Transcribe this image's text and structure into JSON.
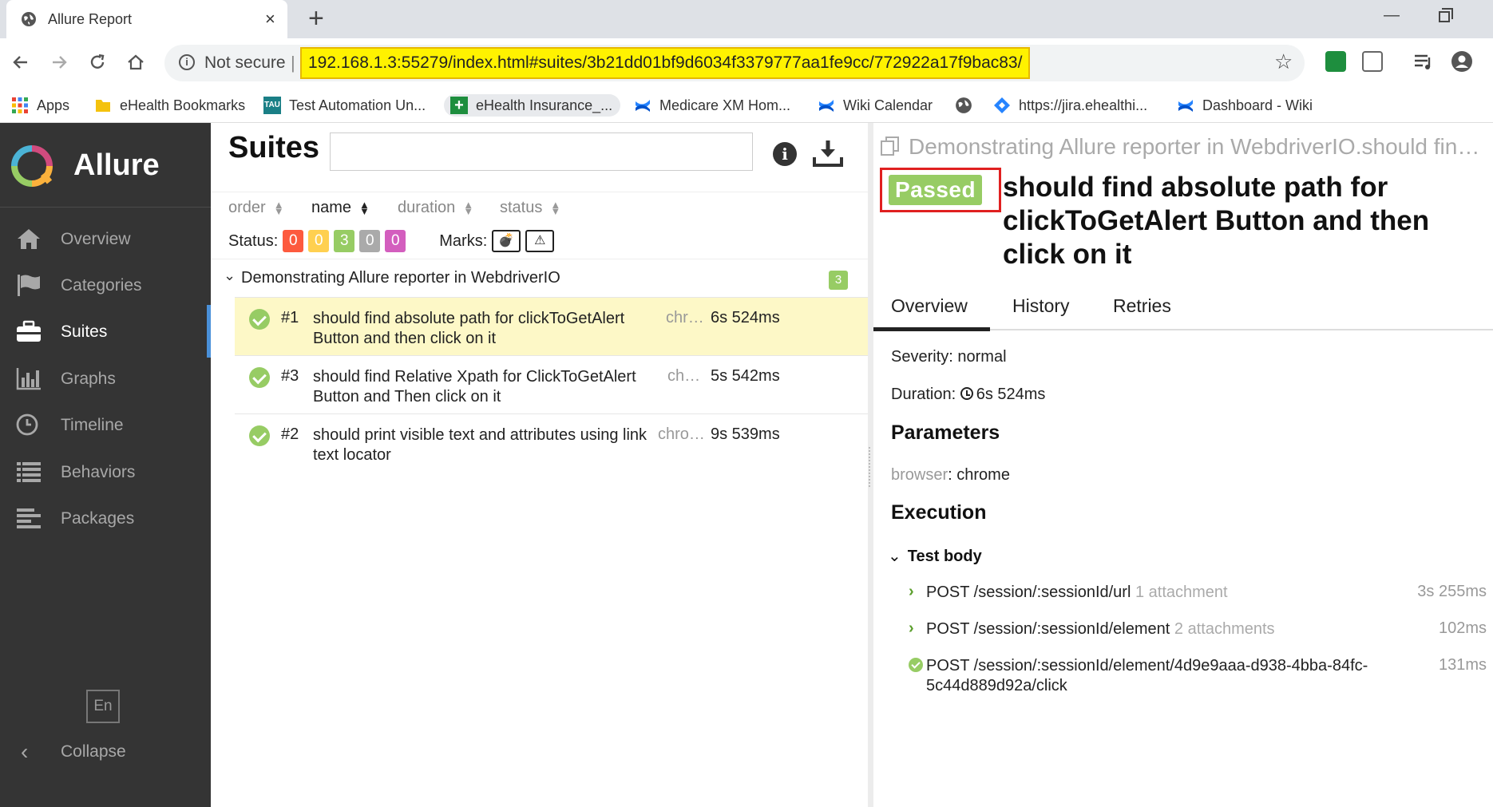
{
  "browser": {
    "tab_title": "Allure Report",
    "tab_close": "×",
    "new_tab": "+",
    "not_secure": "Not secure",
    "url": "192.168.1.3:55279/index.html#suites/3b21dd01bf9d6034f3379777aa1fe9cc/772922a17f9bac83/",
    "window_min": "—",
    "bookmarks": [
      {
        "label": "Apps",
        "icon": "apps-grid-icon"
      },
      {
        "label": "eHealth Bookmarks",
        "icon": "folder-icon"
      },
      {
        "label": "Test Automation Un...",
        "icon": "tau-icon"
      },
      {
        "label": "eHealth Insurance_...",
        "icon": "plus-green-icon"
      },
      {
        "label": "Medicare XM Hom...",
        "icon": "confluence-icon"
      },
      {
        "label": "Wiki Calendar",
        "icon": "confluence-icon"
      },
      {
        "label": "https://jira.ehealthi...",
        "icon": "jira-icon"
      },
      {
        "label": "Dashboard - Wiki",
        "icon": "confluence-icon"
      }
    ]
  },
  "sidebar": {
    "brand": "Allure",
    "items": [
      {
        "label": "Overview",
        "icon": "home-icon"
      },
      {
        "label": "Categories",
        "icon": "flag-icon"
      },
      {
        "label": "Suites",
        "icon": "briefcase-icon",
        "active": true
      },
      {
        "label": "Graphs",
        "icon": "bar-chart-icon"
      },
      {
        "label": "Timeline",
        "icon": "clock-icon"
      },
      {
        "label": "Behaviors",
        "icon": "list-icon"
      },
      {
        "label": "Packages",
        "icon": "align-left-icon"
      }
    ],
    "language": "En",
    "collapse": "Collapse"
  },
  "suites": {
    "title": "Suites",
    "sort": {
      "order": "order",
      "name": "name",
      "duration": "duration",
      "status": "status"
    },
    "status_label": "Status:",
    "status_counts": [
      {
        "value": "0",
        "color": "#fd5a3e"
      },
      {
        "value": "0",
        "color": "#ffd050"
      },
      {
        "value": "3",
        "color": "#97cc64"
      },
      {
        "value": "0",
        "color": "#aaaaaa"
      },
      {
        "value": "0",
        "color": "#d35ebe"
      }
    ],
    "marks_label": "Marks:",
    "group": {
      "name": "Demonstrating Allure reporter in WebdriverIO",
      "count": "3"
    },
    "rows": [
      {
        "num": "#1",
        "name": "should find absolute path for clickToGetAlert Button and then click on it",
        "browser": "chr…",
        "duration": "6s 524ms",
        "selected": true
      },
      {
        "num": "#3",
        "name": "should find Relative Xpath for ClickToGetAlert Button and Then click on it",
        "browser": "ch…",
        "duration": "5s 542ms"
      },
      {
        "num": "#2",
        "name": "should print visible text and attributes using link text locator",
        "browser": "chro…",
        "duration": "9s 539ms"
      }
    ]
  },
  "detail": {
    "crumb": "Demonstrating Allure reporter in WebdriverIO.should find ab...",
    "status": "Passed",
    "title": "should find absolute path for clickToGetAlert Button and then click on it",
    "tabs": [
      "Overview",
      "History",
      "Retries"
    ],
    "severity_label": "Severity:",
    "severity": "normal",
    "duration_label": "Duration:",
    "duration": "6s 524ms",
    "parameters_heading": "Parameters",
    "param_key": "browser",
    "param_value": ": chrome",
    "execution_heading": "Execution",
    "test_body": "Test body",
    "steps": [
      {
        "text": "POST /session/:sessionId/url",
        "attachments": "1 attachment",
        "duration": "3s 255ms"
      },
      {
        "text": "POST /session/:sessionId/element",
        "attachments": "2 attachments",
        "duration": "102ms"
      },
      {
        "text": "POST /session/:sessionId/element/4d9e9aaa-d938-4bba-84fc-5c44d889d92a/click",
        "attachments": "",
        "duration": "131ms"
      }
    ]
  }
}
